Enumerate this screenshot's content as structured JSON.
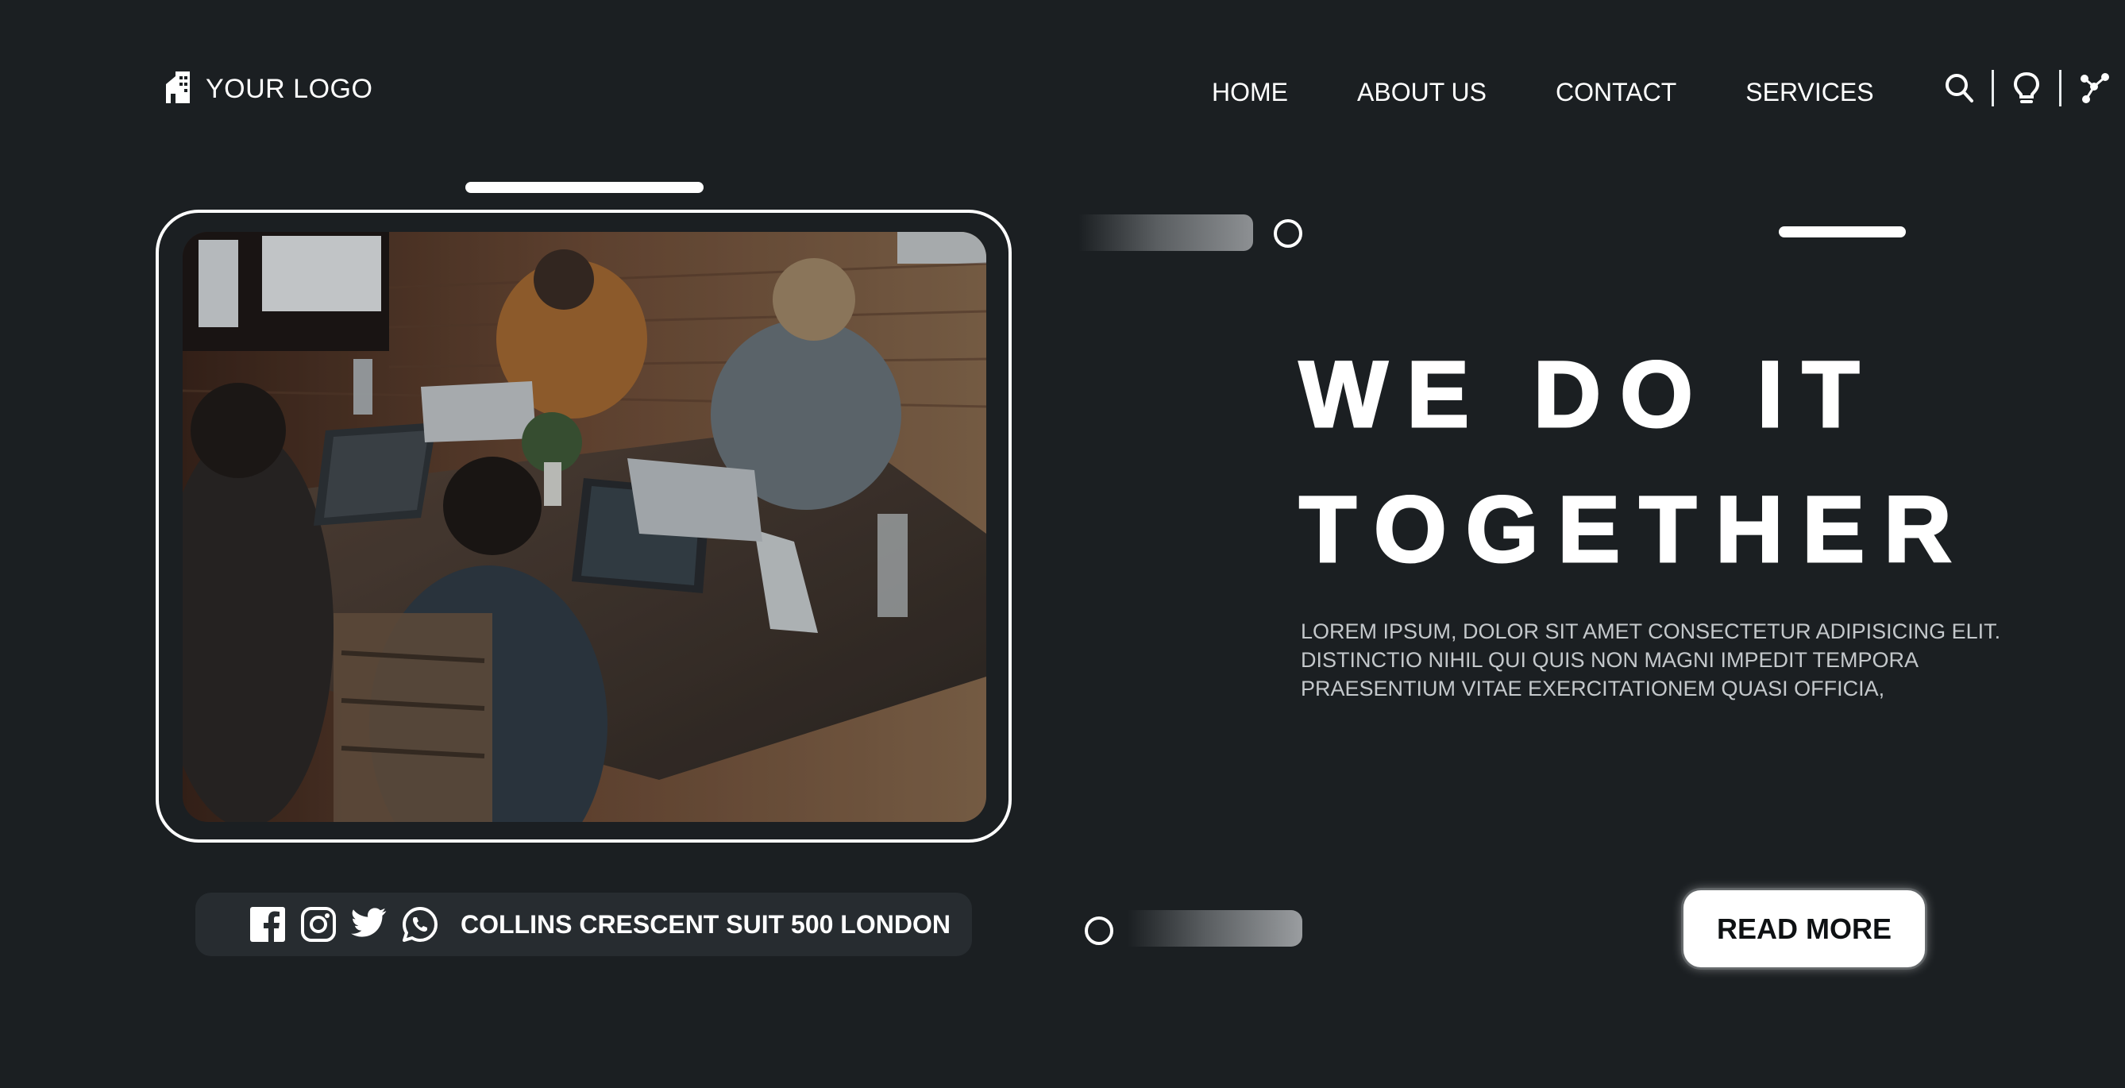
{
  "header": {
    "logo_icon": "building-icon",
    "logo_text": "YOUR LOGO",
    "nav": [
      {
        "label": "HOME"
      },
      {
        "label": "ABOUT US"
      },
      {
        "label": "CONTACT"
      },
      {
        "label": "SERVICES"
      }
    ],
    "tools": [
      "search-icon",
      "lightbulb-icon",
      "share-network-icon"
    ]
  },
  "hero": {
    "image_subject": "team working on laptops around a wooden table",
    "headline_line1": "WE DO IT",
    "headline_line2": "TOGETHER",
    "body": "LOREM IPSUM, DOLOR SIT AMET CONSECTETUR ADIPISICING ELIT. DISTINCTIO NIHIL QUI QUIS NON MAGNI IMPEDIT TEMPORA PRAESENTIUM VITAE EXERCITATIONEM QUASI OFFICIA,",
    "cta_label": "READ MORE"
  },
  "footer": {
    "social": [
      "facebook-icon",
      "instagram-icon",
      "twitter-icon",
      "whatsapp-icon"
    ],
    "address": "COLLINS CRESCENT SUIT 500 LONDON"
  },
  "colors": {
    "background": "#1b1f22",
    "pill": "#272c30",
    "text": "#ffffff",
    "muted_text": "#c4c8cb"
  }
}
